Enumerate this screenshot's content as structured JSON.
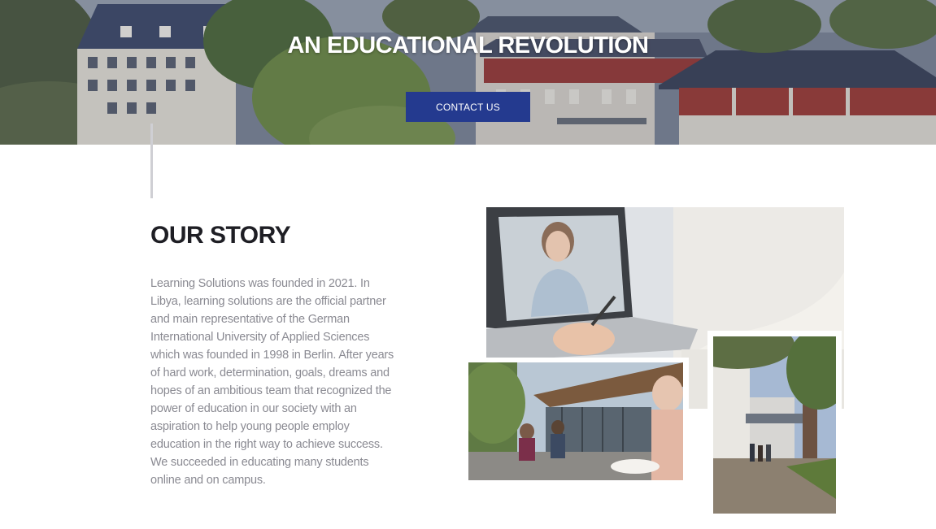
{
  "hero": {
    "title": "AN EDUCATIONAL REVOLUTION",
    "contact_label": "CONTACT US",
    "accent_color": "#243a8f"
  },
  "story": {
    "heading": "OUR STORY",
    "paragraph": "Learning Solutions was founded in 2021. In Libya, learning solutions are the official partner and main representative of the German International University of Applied Sciences which was founded in 1998 in Berlin. After years of hard work, determination, goals, dreams and hopes of an ambitious team that recognized the power of education in our society with an aspiration to help young people employ education in the right way to achieve success. We succeeded in educating many students online and on campus."
  }
}
